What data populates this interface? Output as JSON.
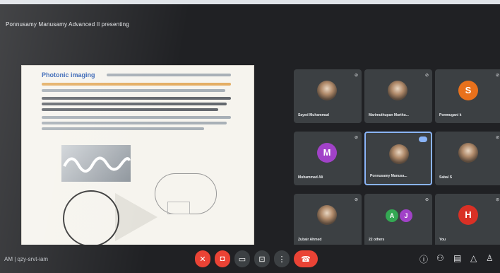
{
  "presenter": {
    "title": "Ponnusamy Manusamy Advanced Il presenting"
  },
  "slide": {
    "heading": "Photonic imaging"
  },
  "participants": [
    {
      "name": "Sayed Muhammad",
      "initial": "",
      "color": "",
      "photo": true,
      "mic": "off"
    },
    {
      "name": "Marimuthupan Murthu...",
      "initial": "",
      "color": "",
      "photo": true,
      "mic": "off"
    },
    {
      "name": "Ponmugani k",
      "initial": "S",
      "color": "#e8711c",
      "photo": false,
      "mic": "off"
    },
    {
      "name": "Muhammad Ali",
      "initial": "M",
      "color": "#a142c8",
      "photo": false,
      "mic": "off"
    },
    {
      "name": "Ponnusamy Manusa...",
      "initial": "",
      "color": "",
      "photo": true,
      "mic": "on",
      "speaking": true
    },
    {
      "name": "Sabal S",
      "initial": "",
      "color": "",
      "photo": true,
      "mic": "off"
    },
    {
      "name": "Zubair Ahmed",
      "initial": "",
      "color": "",
      "photo": true,
      "mic": "off"
    },
    {
      "name": "22 others",
      "initial": "",
      "color": "",
      "photo": false,
      "mic": "off"
    },
    {
      "name": "You",
      "initial": "H",
      "color": "#d93025",
      "photo": false,
      "mic": "off"
    }
  ],
  "others_avatars": [
    {
      "initial": "A",
      "color": "#34a853"
    },
    {
      "initial": "J",
      "color": "#a142c8"
    }
  ],
  "meeting": {
    "info": "AM  |  qzy-srvt-iam"
  },
  "controls": {
    "mic": "mic-off-icon",
    "cam": "camera-off-icon",
    "cc": "captions-icon",
    "present": "present-icon",
    "more": "more-icon",
    "end": "end-call-icon"
  }
}
